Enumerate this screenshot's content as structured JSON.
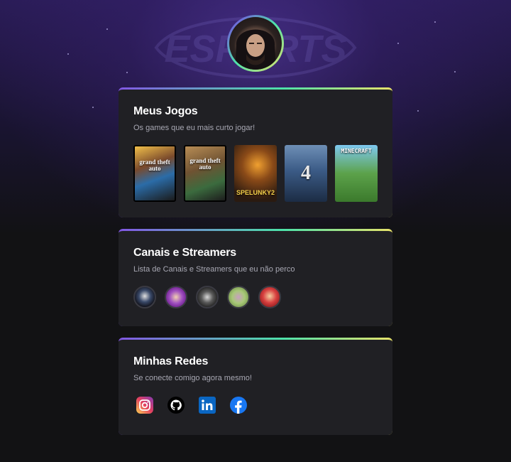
{
  "background_logo": {
    "text": "ESPORTS"
  },
  "profile": {
    "avatar": "profile-avatar"
  },
  "games_section": {
    "title": "Meus Jogos",
    "subtitle": "Os games que eu mais curto jogar!",
    "games": [
      {
        "name": "Grand Theft Auto V",
        "cover_text": "grand theft auto"
      },
      {
        "name": "Grand Theft Auto San Andreas",
        "cover_text": "grand theft auto"
      },
      {
        "name": "Spelunky 2",
        "cover_text": "SPELUNKY2"
      },
      {
        "name": "Resident Evil 4",
        "cover_text": "4"
      },
      {
        "name": "Minecraft",
        "cover_text": "MINECRAFT"
      }
    ]
  },
  "channels_section": {
    "title": "Canais e Streamers",
    "subtitle": "Lista de Canais e Streamers que eu não perco"
  },
  "social_section": {
    "title": "Minhas Redes",
    "subtitle": "Se conecte comigo agora mesmo!",
    "icons": [
      "instagram-icon",
      "github-icon",
      "linkedin-icon",
      "facebook-icon"
    ]
  },
  "colors": {
    "page_bg": "#121214",
    "card_bg": "#202024",
    "gradient": [
      "#8257e5",
      "#4de2a9",
      "#e8e36a"
    ],
    "text_primary": "#ffffff",
    "text_secondary": "#a8a8b3"
  }
}
